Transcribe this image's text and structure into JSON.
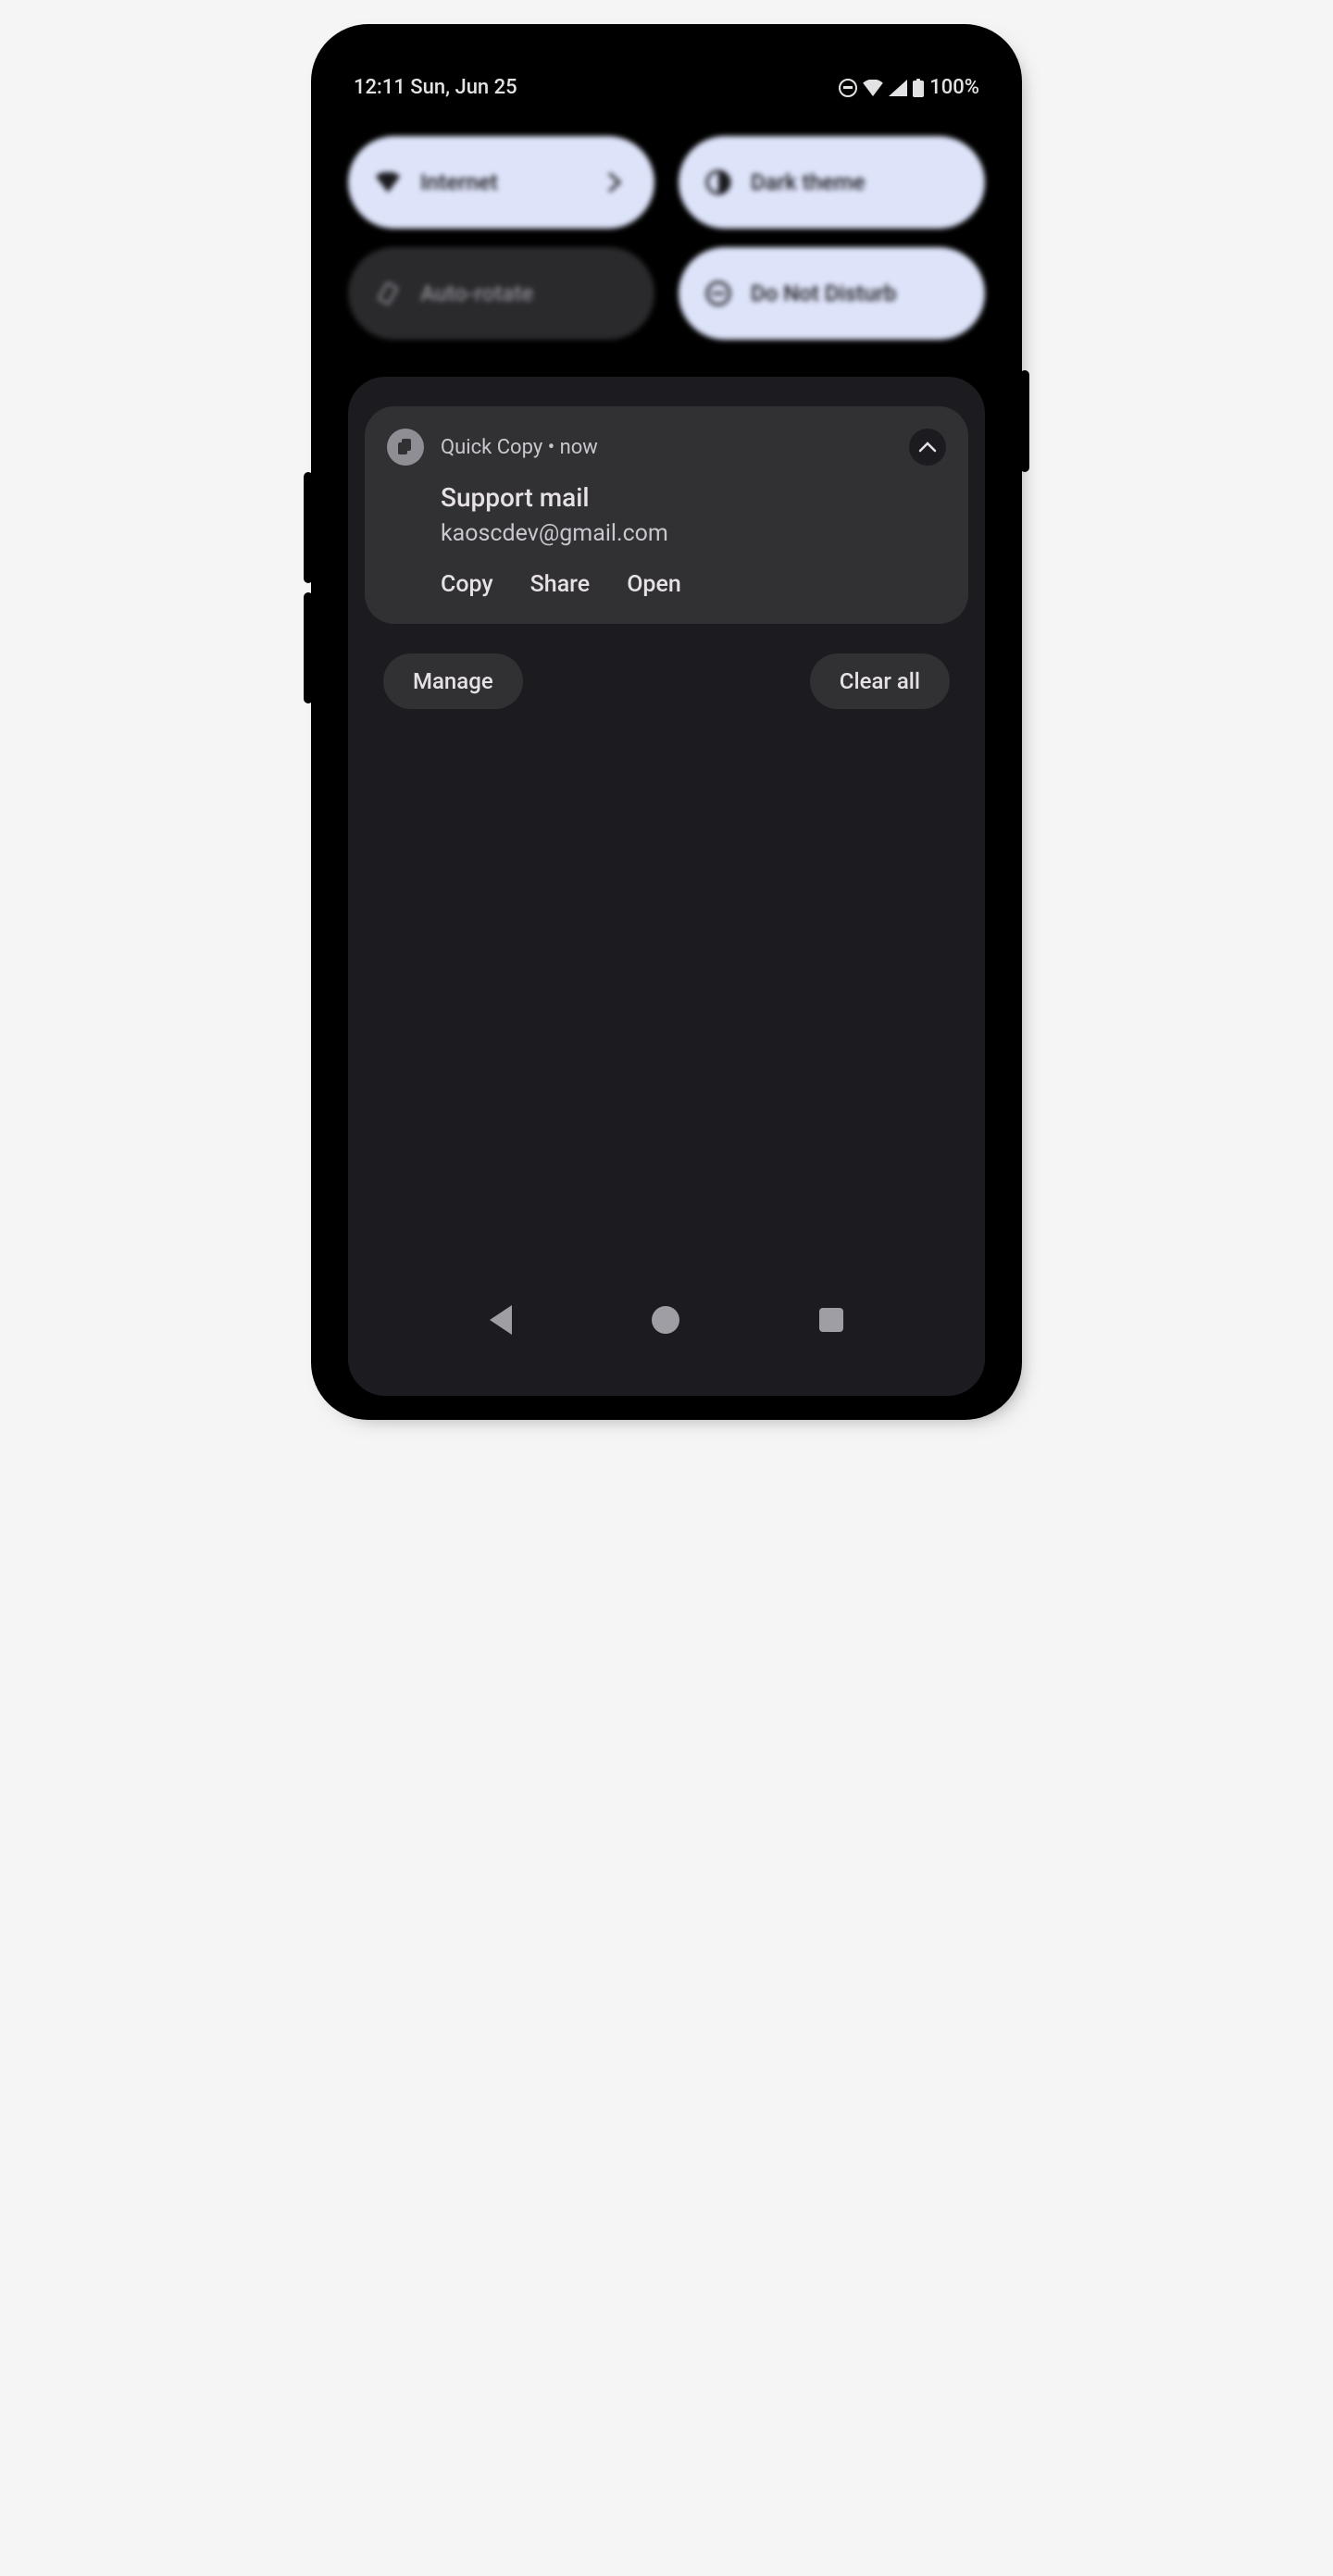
{
  "status": {
    "time_date": "12:11 Sun, Jun 25",
    "battery": "100%"
  },
  "quick_settings": {
    "internet": {
      "label": "Internet",
      "on": true
    },
    "dark_theme": {
      "label": "Dark theme",
      "on": true
    },
    "auto_rotate": {
      "label": "Auto-rotate",
      "on": false
    },
    "dnd": {
      "label": "Do Not Disturb",
      "on": true
    }
  },
  "notification": {
    "app": "Quick Copy",
    "sep": " • ",
    "when": "now",
    "title": "Support mail",
    "text": "kaoscdev@gmail.com",
    "actions": {
      "copy": "Copy",
      "share": "Share",
      "open": "Open"
    }
  },
  "footer": {
    "manage": "Manage",
    "clear_all": "Clear all"
  }
}
